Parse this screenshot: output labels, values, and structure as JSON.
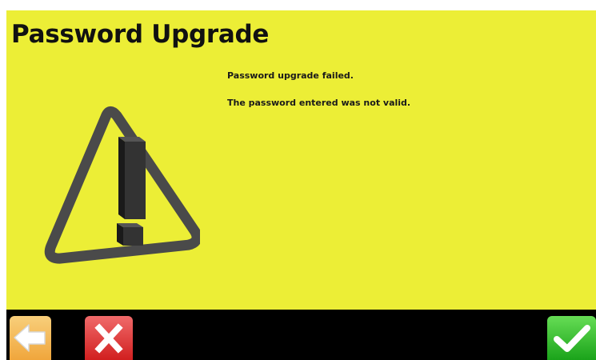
{
  "dialog": {
    "title": "Password Upgrade",
    "messages": [
      "Password upgrade failed.",
      "The password entered was not valid."
    ],
    "icon": "warning-triangle-icon"
  },
  "toolbar": {
    "back_icon": "back-arrow-icon",
    "cancel_icon": "close-x-icon",
    "ok_icon": "checkmark-icon"
  },
  "colors": {
    "panel_background": "#ecee36",
    "toolbar_background": "#000000",
    "back_button": "#f2b04e",
    "cancel_button": "#e03333",
    "ok_button": "#33bb2e"
  }
}
